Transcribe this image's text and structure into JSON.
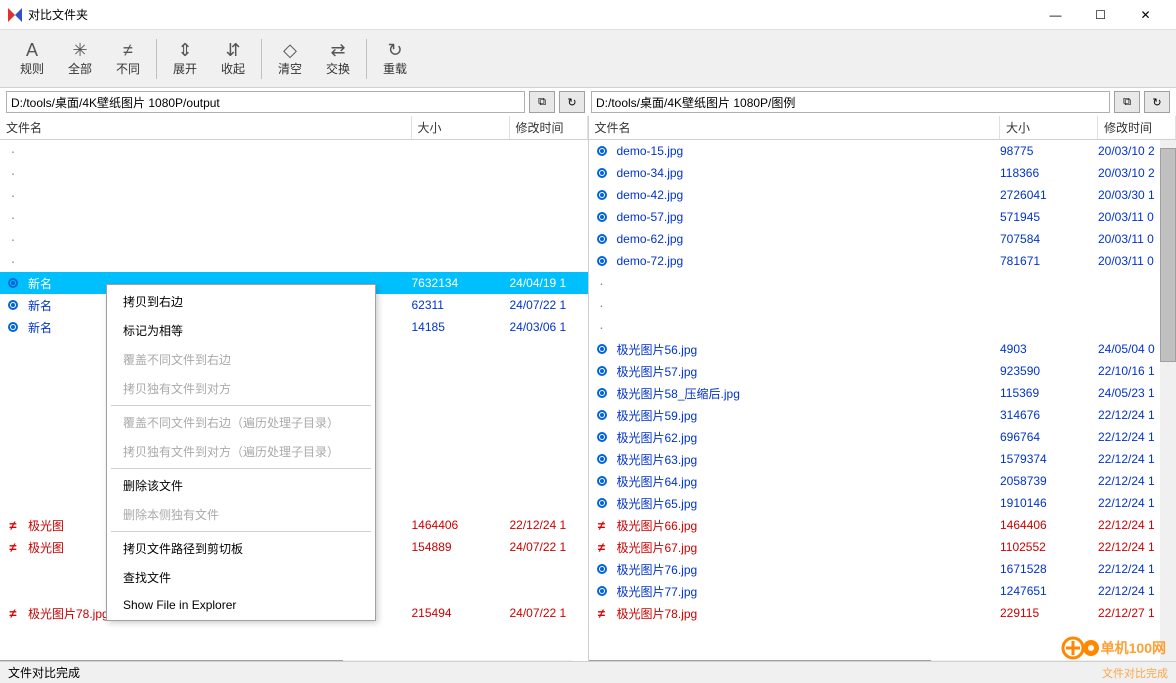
{
  "window": {
    "title": "对比文件夹"
  },
  "toolbar": [
    {
      "icon": "A",
      "label": "规则"
    },
    {
      "icon": "✳",
      "label": "全部"
    },
    {
      "icon": "≠",
      "label": "不同"
    },
    {
      "icon": "⇕",
      "label": "展开"
    },
    {
      "icon": "⇵",
      "label": "收起"
    },
    {
      "icon": "◇",
      "label": "清空"
    },
    {
      "icon": "⇄",
      "label": "交换"
    },
    {
      "icon": "↻",
      "label": "重载"
    }
  ],
  "paths": {
    "left": "D:/tools/桌面/4K壁纸图片 1080P/output",
    "right": "D:/tools/桌面/4K壁纸图片 1080P/图例"
  },
  "columns": {
    "name": "文件名",
    "size": "大小",
    "time": "修改时间"
  },
  "left_files": [
    {
      "marker": "dot",
      "name": "",
      "size": "",
      "time": "",
      "cls": ""
    },
    {
      "marker": "dot",
      "name": "",
      "size": "",
      "time": "",
      "cls": ""
    },
    {
      "marker": "dot",
      "name": "",
      "size": "",
      "time": "",
      "cls": ""
    },
    {
      "marker": "dot",
      "name": "",
      "size": "",
      "time": "",
      "cls": ""
    },
    {
      "marker": "dot",
      "name": "",
      "size": "",
      "time": "",
      "cls": ""
    },
    {
      "marker": "dot",
      "name": "",
      "size": "",
      "time": "",
      "cls": ""
    },
    {
      "marker": "bullet",
      "name": "新名",
      "size": "7632134",
      "time": "24/04/19 1",
      "cls": "blue",
      "selected": true
    },
    {
      "marker": "bullet",
      "name": "新名",
      "size": "62311",
      "time": "24/07/22 1",
      "cls": "blue"
    },
    {
      "marker": "bullet",
      "name": "新名",
      "size": "14185",
      "time": "24/03/06 1",
      "cls": "blue"
    },
    {
      "marker": "",
      "name": "",
      "size": "",
      "time": "",
      "cls": ""
    },
    {
      "marker": "",
      "name": "",
      "size": "",
      "time": "",
      "cls": ""
    },
    {
      "marker": "",
      "name": "",
      "size": "",
      "time": "",
      "cls": ""
    },
    {
      "marker": "",
      "name": "",
      "size": "",
      "time": "",
      "cls": ""
    },
    {
      "marker": "",
      "name": "",
      "size": "",
      "time": "",
      "cls": ""
    },
    {
      "marker": "",
      "name": "",
      "size": "",
      "time": "",
      "cls": ""
    },
    {
      "marker": "",
      "name": "",
      "size": "",
      "time": "",
      "cls": ""
    },
    {
      "marker": "",
      "name": "",
      "size": "",
      "time": "",
      "cls": ""
    },
    {
      "marker": "neq",
      "name": "极光图",
      "size": "1464406",
      "time": "22/12/24 1",
      "cls": "red"
    },
    {
      "marker": "neq",
      "name": "极光图",
      "size": "154889",
      "time": "24/07/22 1",
      "cls": "red"
    },
    {
      "marker": "",
      "name": "",
      "size": "",
      "time": "",
      "cls": ""
    },
    {
      "marker": "",
      "name": "",
      "size": "",
      "time": "",
      "cls": ""
    },
    {
      "marker": "neq",
      "name": "极光图片78.jpg",
      "size": "215494",
      "time": "24/07/22 1",
      "cls": "red"
    }
  ],
  "right_files": [
    {
      "marker": "bullet",
      "name": "demo-15.jpg",
      "size": "98775",
      "time": "20/03/10 2",
      "cls": "blue"
    },
    {
      "marker": "bullet",
      "name": "demo-34.jpg",
      "size": "118366",
      "time": "20/03/10 2",
      "cls": "blue"
    },
    {
      "marker": "bullet",
      "name": "demo-42.jpg",
      "size": "2726041",
      "time": "20/03/30 1",
      "cls": "blue"
    },
    {
      "marker": "bullet",
      "name": "demo-57.jpg",
      "size": "571945",
      "time": "20/03/11 0",
      "cls": "blue"
    },
    {
      "marker": "bullet",
      "name": "demo-62.jpg",
      "size": "707584",
      "time": "20/03/11 0",
      "cls": "blue"
    },
    {
      "marker": "bullet",
      "name": "demo-72.jpg",
      "size": "781671",
      "time": "20/03/11 0",
      "cls": "blue"
    },
    {
      "marker": "dot",
      "name": "",
      "size": "",
      "time": "",
      "cls": ""
    },
    {
      "marker": "dot",
      "name": "",
      "size": "",
      "time": "",
      "cls": ""
    },
    {
      "marker": "dot",
      "name": "",
      "size": "",
      "time": "",
      "cls": ""
    },
    {
      "marker": "bullet",
      "name": "极光图片56.jpg",
      "size": "4903",
      "time": "24/05/04 0",
      "cls": "blue"
    },
    {
      "marker": "bullet",
      "name": "极光图片57.jpg",
      "size": "923590",
      "time": "22/10/16 1",
      "cls": "blue"
    },
    {
      "marker": "bullet",
      "name": "极光图片58_压缩后.jpg",
      "size": "115369",
      "time": "24/05/23 1",
      "cls": "blue"
    },
    {
      "marker": "bullet",
      "name": "极光图片59.jpg",
      "size": "314676",
      "time": "22/12/24 1",
      "cls": "blue"
    },
    {
      "marker": "bullet",
      "name": "极光图片62.jpg",
      "size": "696764",
      "time": "22/12/24 1",
      "cls": "blue"
    },
    {
      "marker": "bullet",
      "name": "极光图片63.jpg",
      "size": "1579374",
      "time": "22/12/24 1",
      "cls": "blue"
    },
    {
      "marker": "bullet",
      "name": "极光图片64.jpg",
      "size": "2058739",
      "time": "22/12/24 1",
      "cls": "blue"
    },
    {
      "marker": "bullet",
      "name": "极光图片65.jpg",
      "size": "1910146",
      "time": "22/12/24 1",
      "cls": "blue"
    },
    {
      "marker": "neq",
      "name": "极光图片66.jpg",
      "size": "1464406",
      "time": "22/12/24 1",
      "cls": "red"
    },
    {
      "marker": "neq",
      "name": "极光图片67.jpg",
      "size": "1102552",
      "time": "22/12/24 1",
      "cls": "red"
    },
    {
      "marker": "bullet",
      "name": "极光图片76.jpg",
      "size": "1671528",
      "time": "22/12/24 1",
      "cls": "blue"
    },
    {
      "marker": "bullet",
      "name": "极光图片77.jpg",
      "size": "1247651",
      "time": "22/12/24 1",
      "cls": "blue"
    },
    {
      "marker": "neq",
      "name": "极光图片78.jpg",
      "size": "229115",
      "time": "22/12/27 1",
      "cls": "red"
    }
  ],
  "context_menu": [
    {
      "label": "拷贝到右边",
      "enabled": true
    },
    {
      "label": "标记为相等",
      "enabled": true
    },
    {
      "label": "覆盖不同文件到右边",
      "enabled": false
    },
    {
      "label": "拷贝独有文件到对方",
      "enabled": false
    },
    {
      "sep": true
    },
    {
      "label": "覆盖不同文件到右边（遍历处理子目录）",
      "enabled": false
    },
    {
      "label": "拷贝独有文件到对方（遍历处理子目录）",
      "enabled": false
    },
    {
      "sep": true
    },
    {
      "label": "删除该文件",
      "enabled": true
    },
    {
      "label": "删除本侧独有文件",
      "enabled": false
    },
    {
      "sep": true
    },
    {
      "label": "拷贝文件路径到剪切板",
      "enabled": true
    },
    {
      "label": "查找文件",
      "enabled": true
    },
    {
      "label": "Show File in Explorer",
      "enabled": true
    }
  ],
  "status": "文件对比完成",
  "watermark": "单机100网"
}
